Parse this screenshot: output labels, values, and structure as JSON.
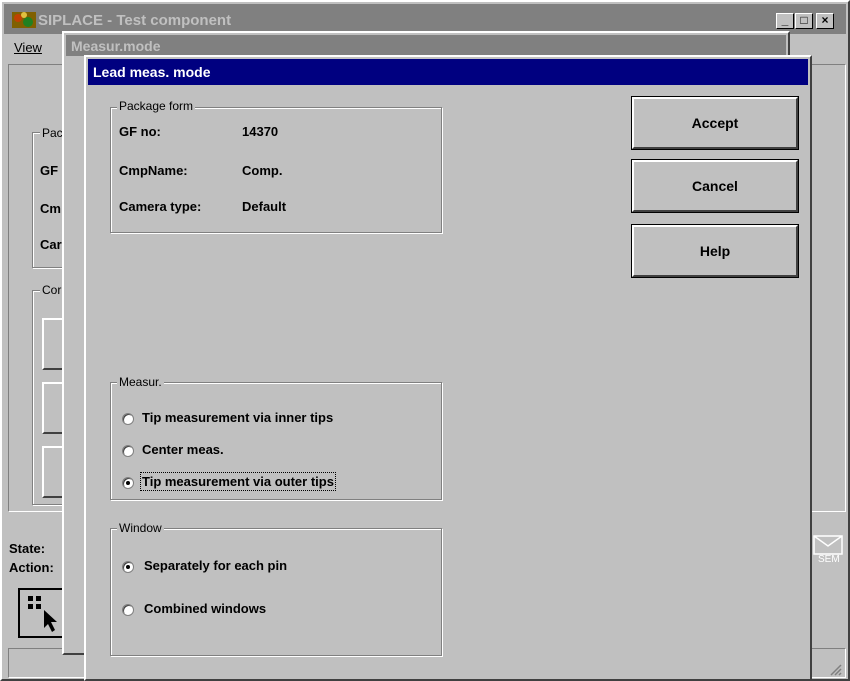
{
  "main_window": {
    "title": "SIPLACE - Test component",
    "menu": {
      "view": "View"
    },
    "left_labels": {
      "package_group": "Pac",
      "gf": "GF",
      "cmp": "Cm",
      "cam": "Car",
      "comp_group": "Cor"
    },
    "state_label": "State:",
    "action_label": "Action:",
    "sem_label": "SEM",
    "minimize_glyph": "_",
    "maximize_glyph": "□",
    "close_glyph": "×"
  },
  "measur_window": {
    "title": "Measur.mode"
  },
  "dialog": {
    "title": "Lead meas. mode",
    "package_form": {
      "legend": "Package form",
      "gf_label": "GF no:",
      "gf_value": "14370",
      "cmp_label": "CmpName:",
      "cmp_value": "Comp.",
      "cam_label": "Camera type:",
      "cam_value": "Default"
    },
    "buttons": {
      "accept": "Accept",
      "cancel": "Cancel",
      "help": "Help"
    },
    "measur": {
      "legend": "Measur.",
      "options": [
        "Tip measurement via inner tips",
        "Center meas.",
        "Tip measurement via outer tips"
      ],
      "selected": 2
    },
    "window": {
      "legend": "Window",
      "options": [
        "Separately for each pin",
        "Combined windows"
      ],
      "selected": 0
    }
  }
}
